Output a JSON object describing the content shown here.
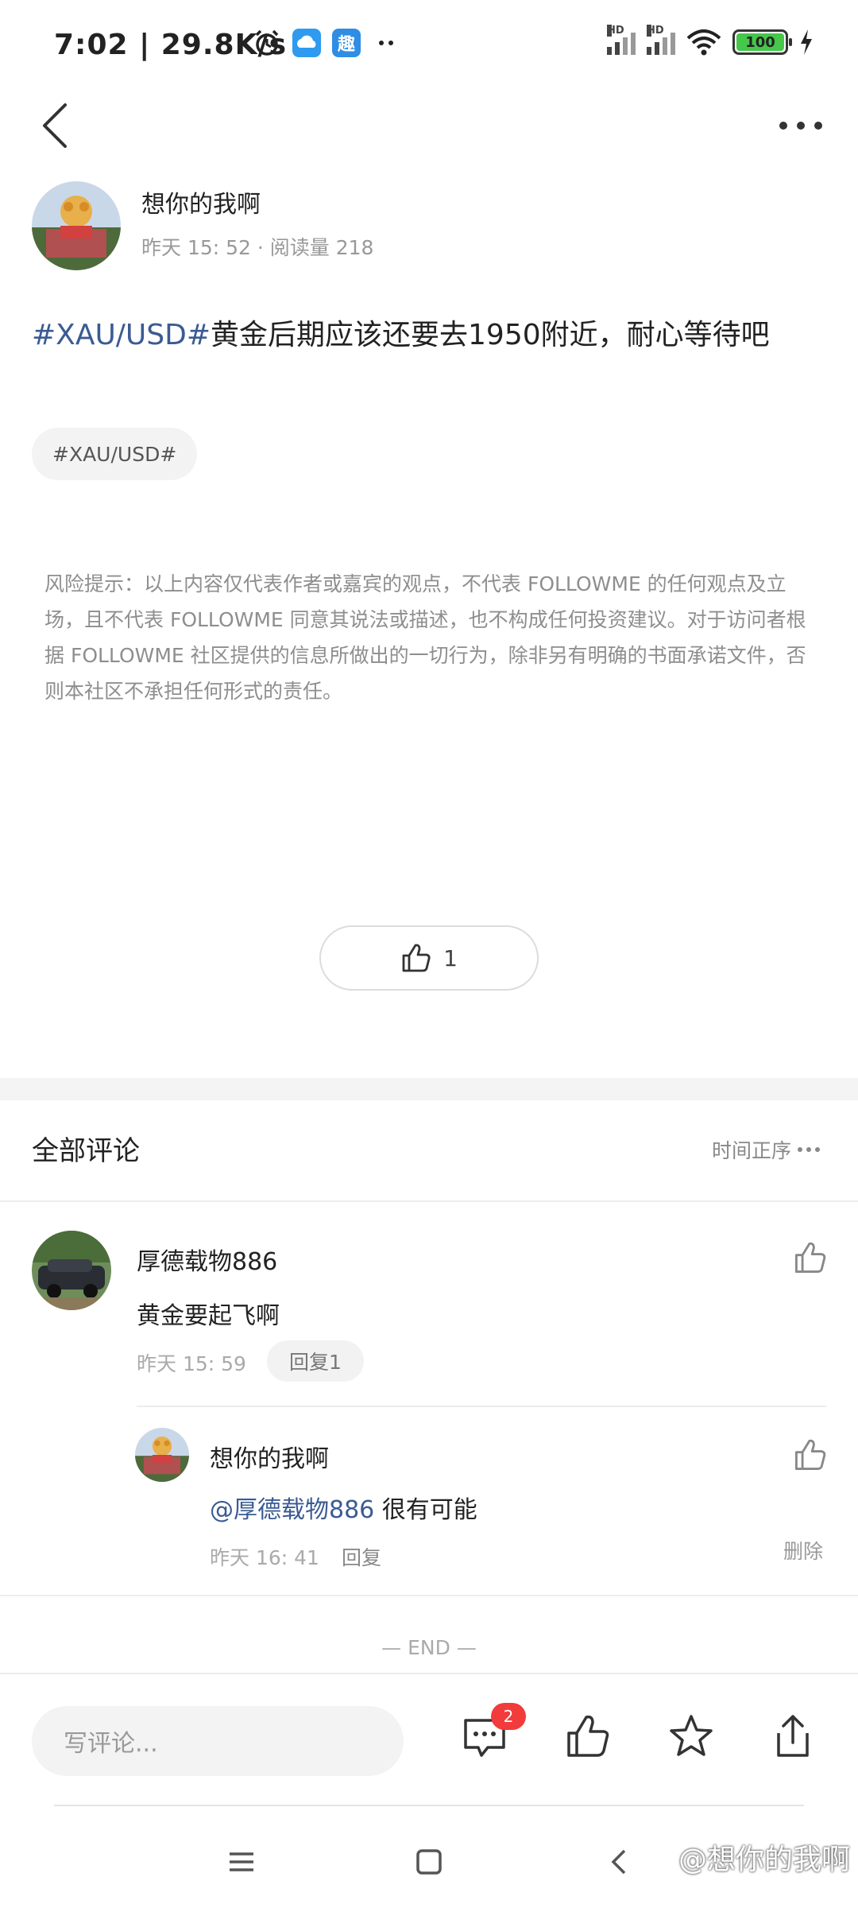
{
  "status_bar": {
    "time_speed": "7:02 | 29.8K/s",
    "app_icon_text": "趣",
    "network_hd_1": "HD",
    "network_hd_2": "HD",
    "battery_level": "100",
    "colors": {
      "battery": "#45c74a",
      "cloud_app": "#2e9bf0",
      "qu_app": "#2f8de4"
    }
  },
  "post": {
    "author_name": "想你的我啊",
    "meta": "昨天 15: 52 · 阅读量 218",
    "tag_text": "#XAU/USD#",
    "body_text": "黄金后期应该还要去1950附近，耐心等待吧",
    "tag_pill": "#XAU/USD#",
    "disclaimer": "风险提示：以上内容仅代表作者或嘉宾的观点，不代表 FOLLOWME 的任何观点及立场，且不代表 FOLLOWME 同意其说法或描述，也不构成任何投资建议。对于访问者根据 FOLLOWME 社区提供的信息所做出的一切行为，除非另有明确的书面承诺文件，否则本社区不承担任何形式的责任。",
    "like_count": "1"
  },
  "comments": {
    "title": "全部评论",
    "sort_label": "时间正序",
    "items": [
      {
        "name": "厚德载物886",
        "text": "黄金要起飞啊",
        "time": "昨天 15: 59",
        "reply_label": "回复1"
      }
    ],
    "reply": {
      "name": "想你的我啊",
      "mention": "@厚德载物886",
      "text": " 很有可能",
      "time": "昨天 16: 41",
      "reply_label": "回复",
      "delete_label": "删除"
    },
    "end_label": "— END —"
  },
  "bottom_bar": {
    "input_placeholder": "写评论...",
    "comment_badge": "2"
  },
  "watermark": "@想你的我啊",
  "accent_link_color": "#3b5b92"
}
